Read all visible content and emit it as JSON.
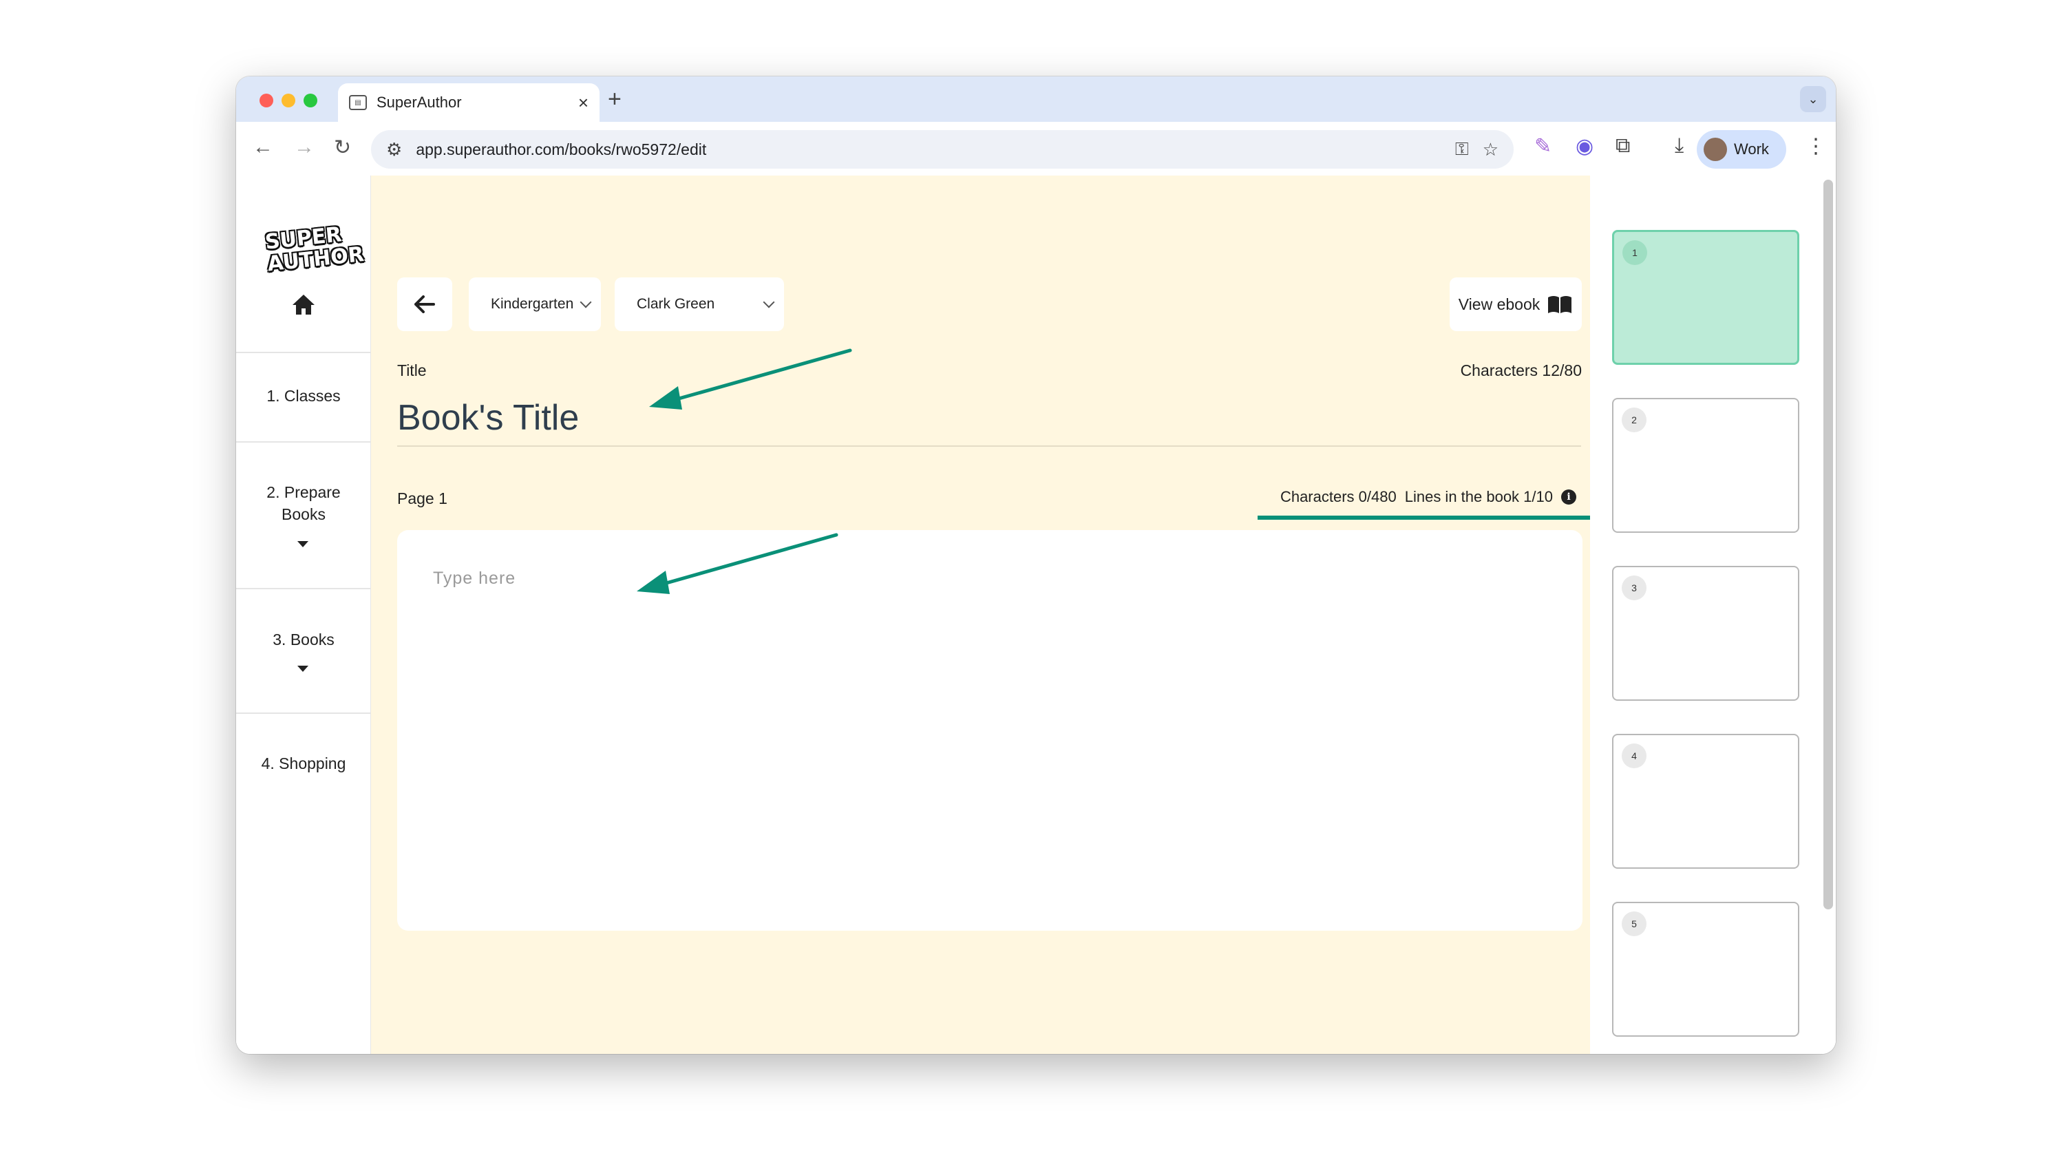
{
  "browser": {
    "tab_title": "SuperAuthor",
    "url": "app.superauthor.com/books/rwo5972/edit",
    "profile_label": "Work"
  },
  "sidebar": {
    "logo_text": "SUPER AUTHOR",
    "items": [
      {
        "label": "1. Classes"
      },
      {
        "label": "2. Prepare Books"
      },
      {
        "label": "3. Books"
      },
      {
        "label": "4. Shopping"
      }
    ]
  },
  "editor": {
    "class_select": "Kindergarten",
    "student_select": "Clark Green",
    "view_ebook_label": "View ebook",
    "title_label": "Title",
    "title_counter": "Characters 12/80",
    "title_value": "Book's Title",
    "page_label": "Page 1",
    "page_char_counter": "Characters 0/480",
    "lines_counter": "Lines in the book 1/10",
    "text_placeholder": "Type here"
  },
  "pages_panel": {
    "thumbnails": [
      {
        "number": "1",
        "active": true
      },
      {
        "number": "2",
        "active": false
      },
      {
        "number": "3",
        "active": false
      },
      {
        "number": "4",
        "active": false
      },
      {
        "number": "5",
        "active": false
      }
    ]
  },
  "colors": {
    "annotation_green": "#0a9078",
    "page_background": "#fff7e0",
    "active_thumb": "#bcebd7"
  }
}
